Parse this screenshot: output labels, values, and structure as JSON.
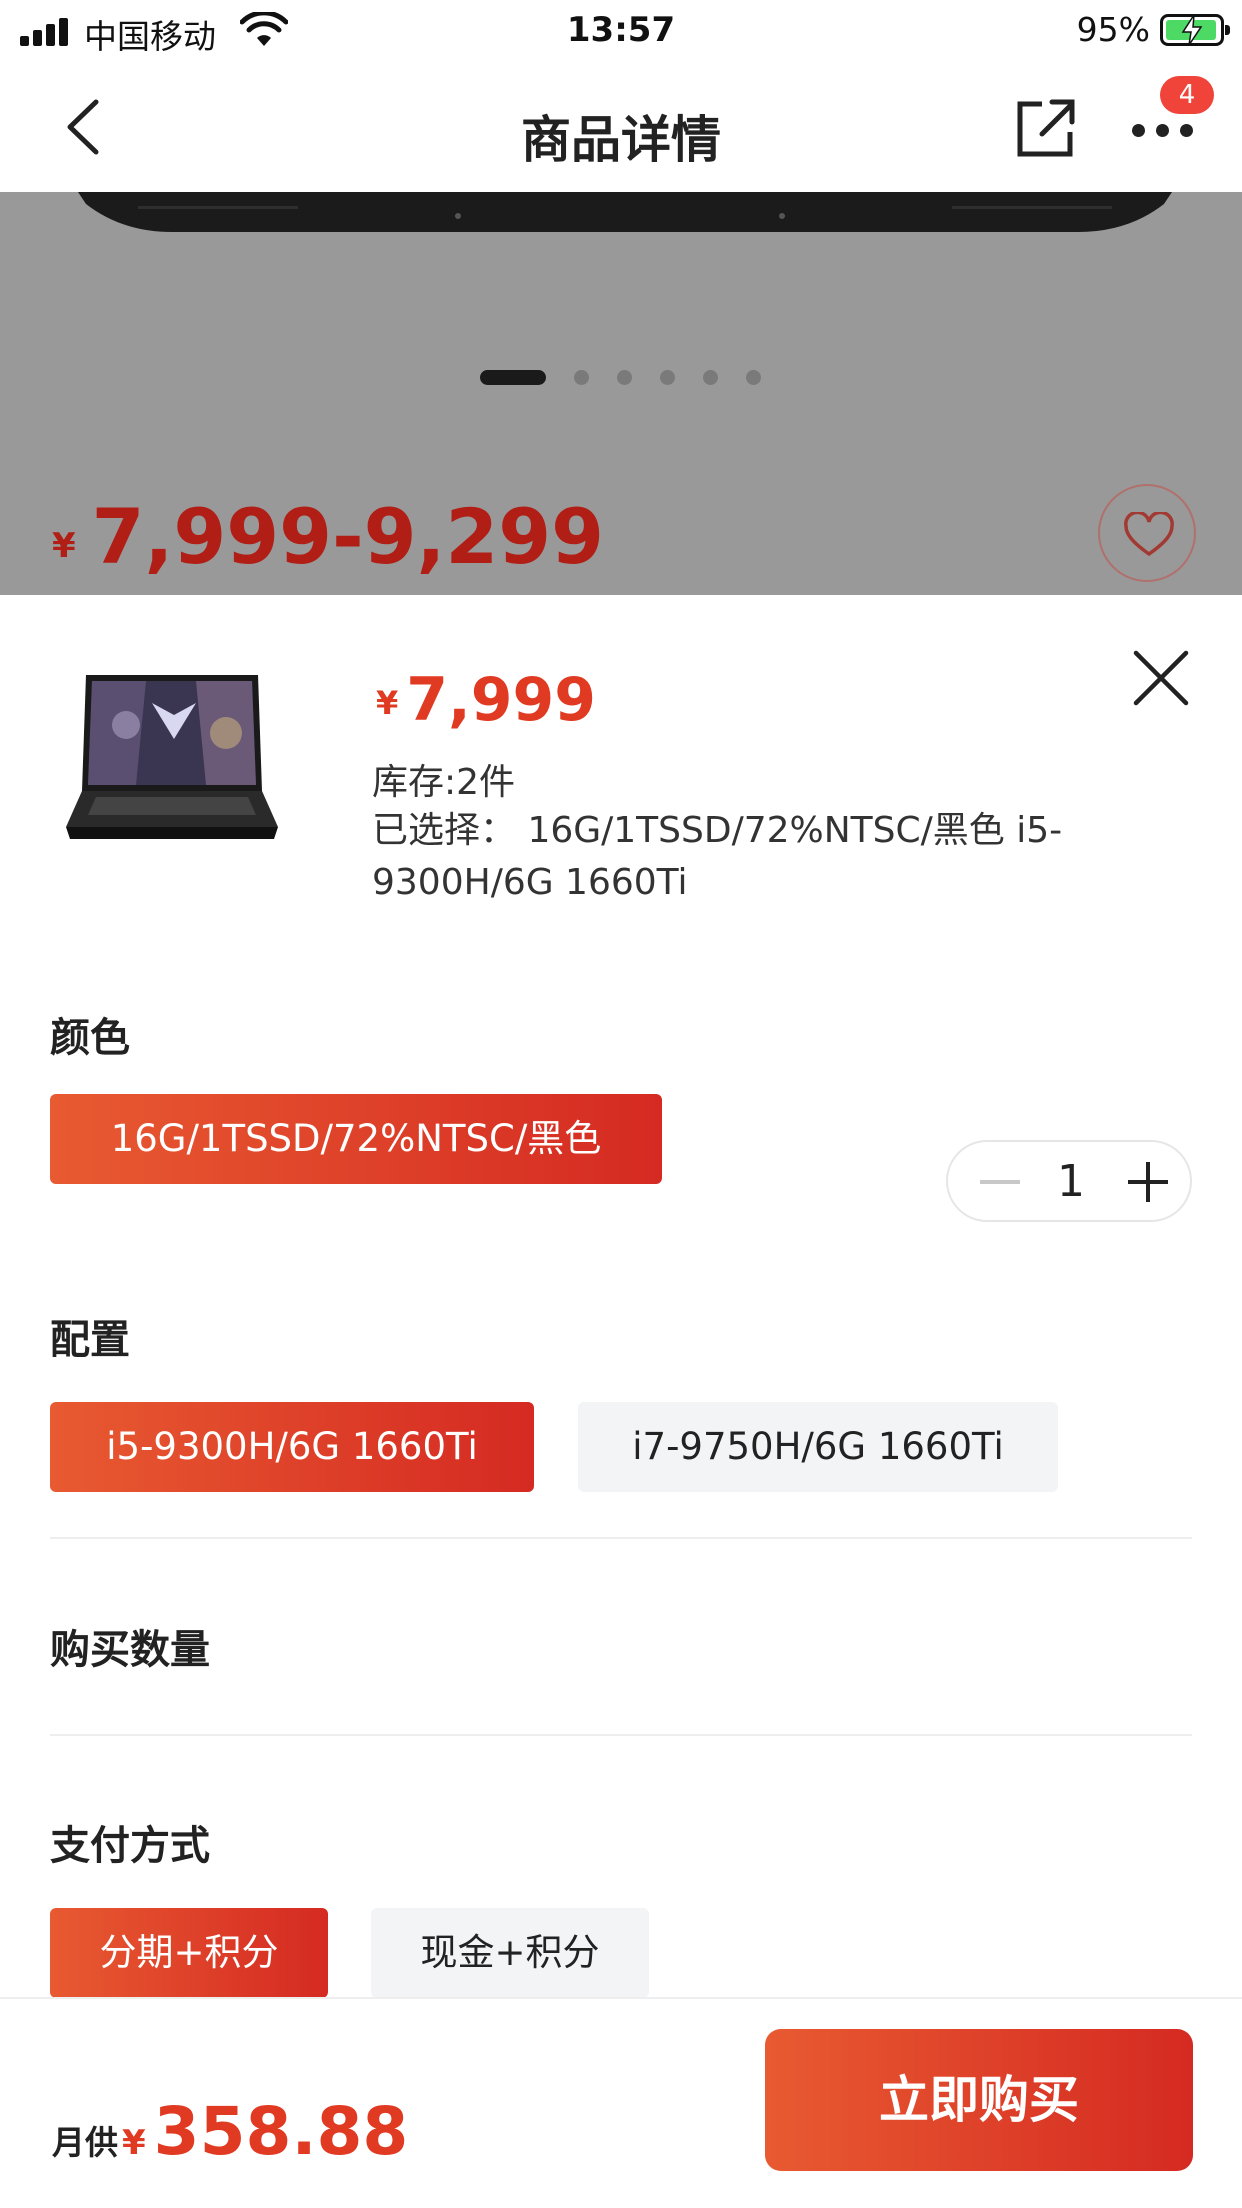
{
  "status_bar": {
    "carrier": "中国移动",
    "time": "13:57",
    "battery_percent": "95%"
  },
  "nav": {
    "title": "商品详情",
    "more_badge": "4"
  },
  "background_page": {
    "price_currency": "¥",
    "price_range": "7,999-9,299",
    "carousel": {
      "count": 6,
      "active_index": 0
    }
  },
  "sheet": {
    "price_currency": "¥",
    "price": "7,999",
    "stock": "库存:2件",
    "selected": "已选择：  16G/1TSSD/72%NTSC/黑色 i5-9300H/6G 1660Ti",
    "color_section": {
      "label": "颜色",
      "options": [
        {
          "label": "16G/1TSSD/72%NTSC/黑色",
          "selected": true
        }
      ]
    },
    "config_section": {
      "label": "配置",
      "options": [
        {
          "label": "i5-9300H/6G 1660Ti",
          "selected": true
        },
        {
          "label": "i7-9750H/6G 1660Ti",
          "selected": false
        }
      ]
    },
    "quantity_section": {
      "label": "购买数量",
      "value": "1"
    },
    "payment_section": {
      "label": "支付方式",
      "options": [
        {
          "label": "分期+积分",
          "selected": true
        },
        {
          "label": "现金+积分",
          "selected": false
        }
      ]
    }
  },
  "action_bar": {
    "monthly_label": "月供",
    "monthly_currency": "¥",
    "monthly_amount": "358.88",
    "buy_label": "立即购买"
  },
  "colors": {
    "accent": "#e03a22",
    "accent_gradient_start": "#e85a31",
    "accent_gradient_end": "#d52a22",
    "badge": "#f0443a",
    "overlay_gray": "#999999"
  },
  "icons": {
    "back": "chevron-left-icon",
    "share": "share-icon",
    "more": "more-dots-icon",
    "favorite": "heart-icon",
    "close": "close-icon"
  }
}
